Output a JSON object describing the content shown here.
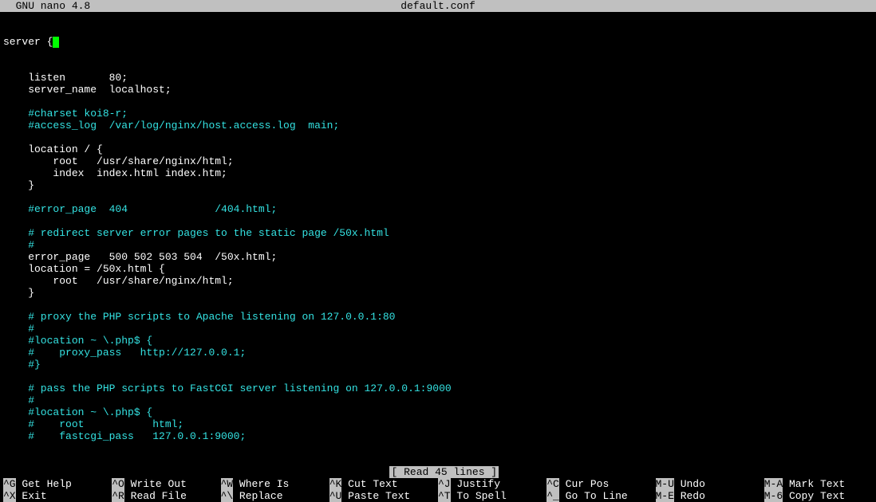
{
  "titlebar": {
    "left": "  GNU nano 4.8",
    "center": "default.conf"
  },
  "editor": {
    "first_line_prefix": "server ",
    "lines": [
      {
        "text": "    listen       80;",
        "cls": "line-white"
      },
      {
        "text": "    server_name  localhost;",
        "cls": "line-white"
      },
      {
        "text": "",
        "cls": "line-white"
      },
      {
        "text": "    #charset koi8-r;",
        "cls": "line-cyan"
      },
      {
        "text": "    #access_log  /var/log/nginx/host.access.log  main;",
        "cls": "line-cyan"
      },
      {
        "text": "",
        "cls": "line-white"
      },
      {
        "text": "    location / {",
        "cls": "line-white"
      },
      {
        "text": "        root   /usr/share/nginx/html;",
        "cls": "line-white"
      },
      {
        "text": "        index  index.html index.htm;",
        "cls": "line-white"
      },
      {
        "text": "    }",
        "cls": "line-white"
      },
      {
        "text": "",
        "cls": "line-white"
      },
      {
        "text": "    #error_page  404              /404.html;",
        "cls": "line-cyan"
      },
      {
        "text": "",
        "cls": "line-white"
      },
      {
        "text": "    # redirect server error pages to the static page /50x.html",
        "cls": "line-cyan"
      },
      {
        "text": "    #",
        "cls": "line-cyan"
      },
      {
        "text": "    error_page   500 502 503 504  /50x.html;",
        "cls": "line-white"
      },
      {
        "text": "    location = /50x.html {",
        "cls": "line-white"
      },
      {
        "text": "        root   /usr/share/nginx/html;",
        "cls": "line-white"
      },
      {
        "text": "    }",
        "cls": "line-white"
      },
      {
        "text": "",
        "cls": "line-white"
      },
      {
        "text": "    # proxy the PHP scripts to Apache listening on 127.0.0.1:80",
        "cls": "line-cyan"
      },
      {
        "text": "    #",
        "cls": "line-cyan"
      },
      {
        "text": "    #location ~ \\.php$ {",
        "cls": "line-cyan"
      },
      {
        "text": "    #    proxy_pass   http://127.0.0.1;",
        "cls": "line-cyan"
      },
      {
        "text": "    #}",
        "cls": "line-cyan"
      },
      {
        "text": "",
        "cls": "line-white"
      },
      {
        "text": "    # pass the PHP scripts to FastCGI server listening on 127.0.0.1:9000",
        "cls": "line-cyan"
      },
      {
        "text": "    #",
        "cls": "line-cyan"
      },
      {
        "text": "    #location ~ \\.php$ {",
        "cls": "line-cyan"
      },
      {
        "text": "    #    root           html;",
        "cls": "line-cyan"
      },
      {
        "text": "    #    fastcgi_pass   127.0.0.1:9000;",
        "cls": "line-cyan"
      }
    ]
  },
  "status": "[ Read 45 lines ]",
  "shortcuts": [
    {
      "key": "^G",
      "label": " Get Help"
    },
    {
      "key": "^O",
      "label": " Write Out"
    },
    {
      "key": "^W",
      "label": " Where Is"
    },
    {
      "key": "^K",
      "label": " Cut Text"
    },
    {
      "key": "^J",
      "label": " Justify"
    },
    {
      "key": "^C",
      "label": " Cur Pos"
    },
    {
      "key": "M-U",
      "label": " Undo"
    },
    {
      "key": "M-A",
      "label": " Mark Text"
    },
    {
      "key": "^X",
      "label": " Exit"
    },
    {
      "key": "^R",
      "label": " Read File"
    },
    {
      "key": "^\\",
      "label": " Replace"
    },
    {
      "key": "^U",
      "label": " Paste Text"
    },
    {
      "key": "^T",
      "label": " To Spell"
    },
    {
      "key": "^_",
      "label": " Go To Line"
    },
    {
      "key": "M-E",
      "label": " Redo"
    },
    {
      "key": "M-6",
      "label": " Copy Text"
    }
  ]
}
